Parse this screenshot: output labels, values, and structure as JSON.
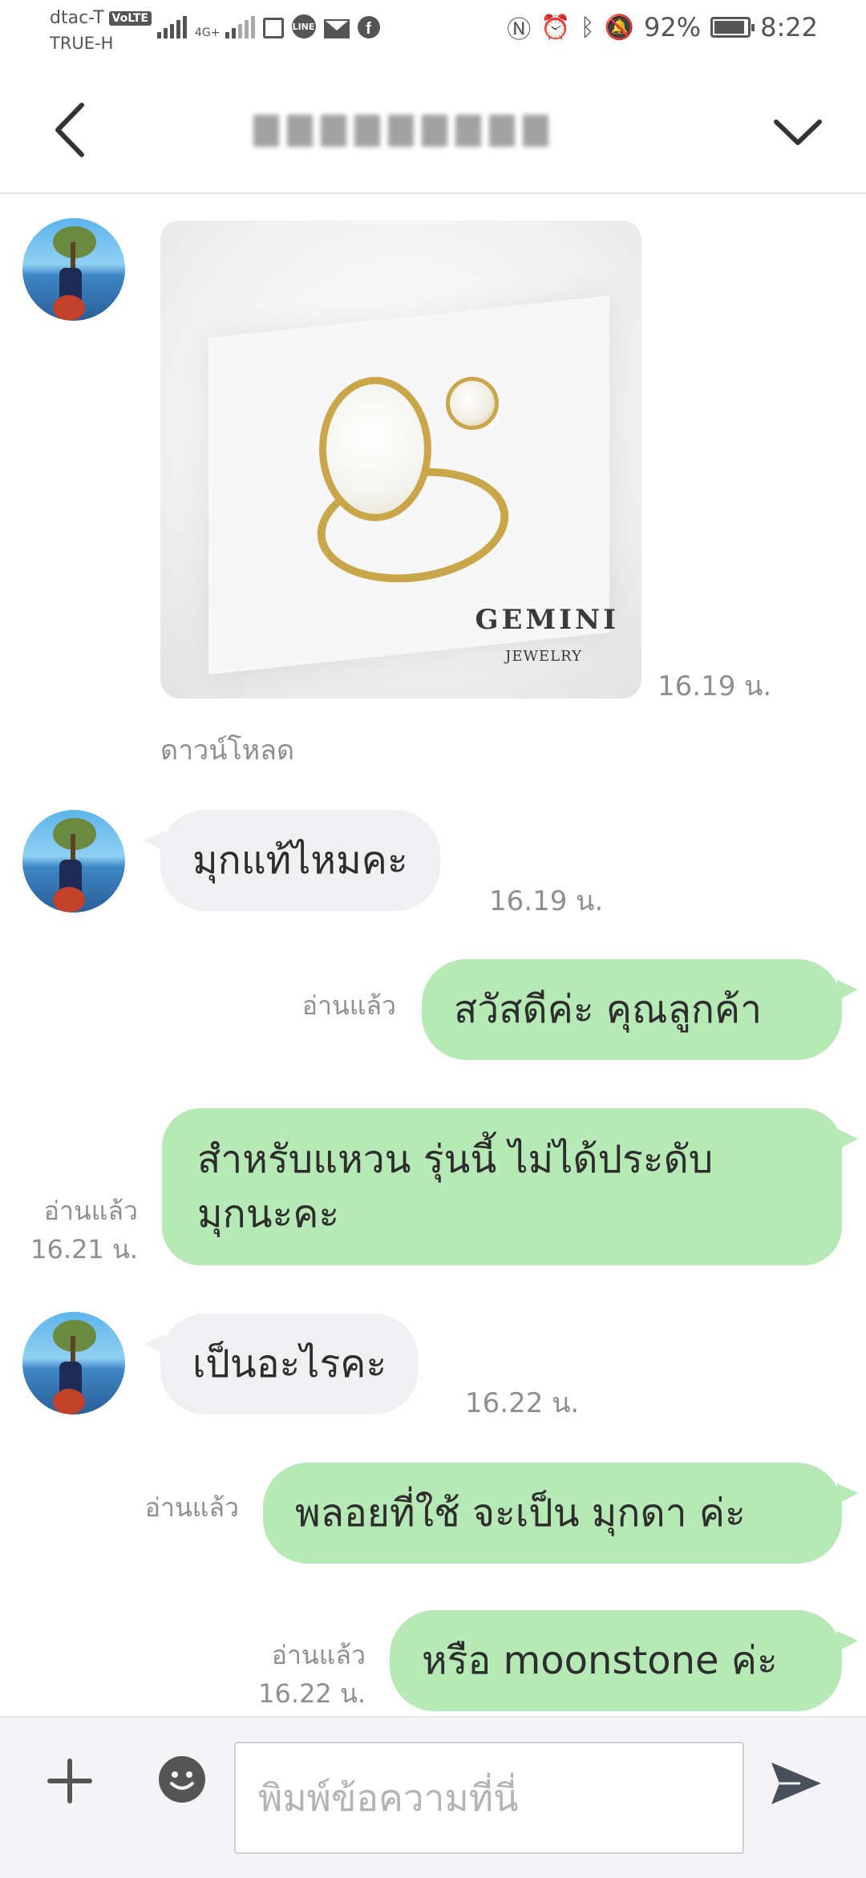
{
  "status_bar": {
    "carrier_1": "dtac-T",
    "volte_badge": "VoLTE",
    "carrier_2": "TRUE-H",
    "network_badge": "4G+",
    "line_badge": "LINE",
    "battery_level": 0.92,
    "battery": "92%",
    "time": "8:22"
  },
  "header": {
    "back_icon": "chevron-left-icon",
    "title_icon": "blurred-contact-name",
    "menu_icon": "chevron-down-icon"
  },
  "messages": {
    "m1": {
      "direction": "in",
      "kind": "image",
      "image_text": "GEMINI",
      "image_subtext": "JEWELRY",
      "time": "16.19 น.",
      "download_label": "ดาวน์โหลด"
    },
    "m2": {
      "direction": "in",
      "text": "มุกแท้ไหมคะ",
      "time": "16.19 น."
    },
    "m3": {
      "direction": "out",
      "text": "สวัสดีค่ะ คุณลูกค้า",
      "read": "อ่านแล้ว"
    },
    "m4": {
      "direction": "out",
      "text_line1": "สำหรับแหวน รุ่นนี้ ไม่ได้ประดับ",
      "text_line2": "มุกนะคะ",
      "read": "อ่านแล้ว",
      "time": "16.21 น."
    },
    "m5": {
      "direction": "in",
      "text": "เป็นอะไรคะ",
      "time": "16.22 น."
    },
    "m6": {
      "direction": "out",
      "text": "พลอยที่ใช้ จะเป็น มุกดา ค่ะ",
      "read": "อ่านแล้ว"
    },
    "m7": {
      "direction": "out",
      "text": "หรือ moonstone ค่ะ",
      "read": "อ่านแล้ว",
      "time": "16.22 น."
    }
  },
  "input_bar": {
    "placeholder": "พิมพ์ข้อความที่นี่",
    "icons": [
      "plus-icon",
      "emoji-icon",
      "send-icon"
    ]
  },
  "colors": {
    "outgoing_bubble": "#b6e9b5",
    "incoming_bubble": "#f0f0f3",
    "meta_text": "#8e8e93",
    "input_bar_bg": "#f5f5f7"
  }
}
